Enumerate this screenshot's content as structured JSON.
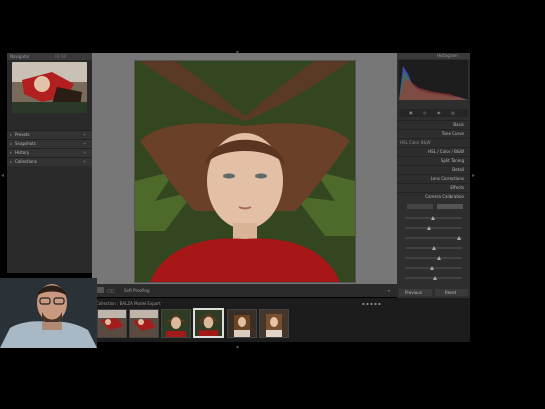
{
  "left_panel": {
    "header": "Navigator",
    "zoom": "Fit  Fill",
    "sections": [
      "Presets",
      "Snapshots",
      "History",
      "Collections"
    ]
  },
  "toolbar": {
    "label": "Soft Proofing"
  },
  "right_panel": {
    "header": "Histogram",
    "panels": [
      "Basic",
      "Tone Curve",
      "HSL / Color / B&W",
      "Split Toning",
      "Detail",
      "Lens Corrections",
      "Effects",
      "Camera Calibration"
    ],
    "hsl_tabs": "HSL  Color  B&W",
    "buttons": {
      "previous": "Previous",
      "reset": "Reset"
    }
  },
  "filmstrip": {
    "path": "Collection : BALZA Model Export",
    "thumb_count": 6,
    "selected_index": 3
  }
}
